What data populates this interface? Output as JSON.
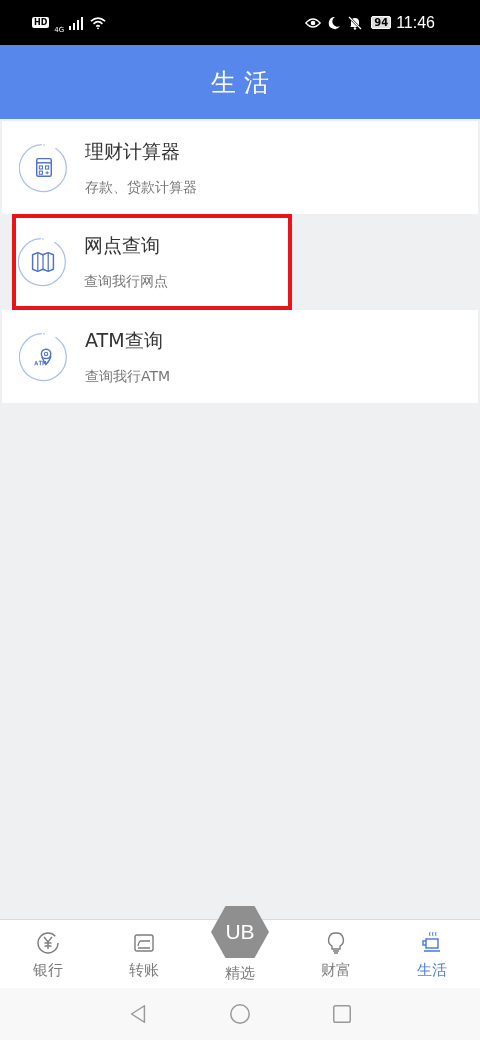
{
  "status_bar": {
    "left": [
      "HD",
      "4G"
    ],
    "battery": "94",
    "time": "11:46"
  },
  "header": {
    "title": "生 活"
  },
  "items": [
    {
      "kind": "calculator",
      "title": "理财计算器",
      "subtitle": "存款、贷款计算器",
      "highlighted": false
    },
    {
      "kind": "map",
      "title": "网点查询",
      "subtitle": "查询我行网点",
      "highlighted": true
    },
    {
      "kind": "atm",
      "title": "ATM查询",
      "subtitle": "查询我行ATM",
      "highlighted": false
    }
  ],
  "tabs": [
    {
      "kind": "yen",
      "label": "银行",
      "selected": false
    },
    {
      "kind": "card",
      "label": "转账",
      "selected": false
    },
    {
      "kind": "logo",
      "label": "精选",
      "logo": "UB",
      "selected": false
    },
    {
      "kind": "bulb",
      "label": "财富",
      "selected": false
    },
    {
      "kind": "cup",
      "label": "生活",
      "selected": true
    }
  ]
}
